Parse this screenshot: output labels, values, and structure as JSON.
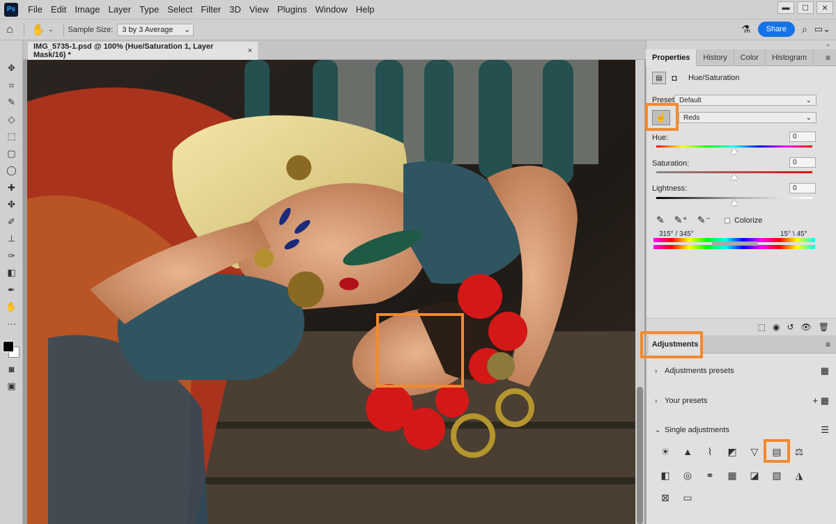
{
  "app": {
    "logo": "Ps"
  },
  "menu": [
    "File",
    "Edit",
    "Image",
    "Layer",
    "Type",
    "Select",
    "Filter",
    "3D",
    "View",
    "Plugins",
    "Window",
    "Help"
  ],
  "window_controls": {
    "minimize": "▬",
    "maximize": "☐",
    "close": "✕"
  },
  "options_bar": {
    "sample_size_label": "Sample Size:",
    "sample_size_value": "3 by 3 Average",
    "share_label": "Share"
  },
  "document": {
    "tab_title": "IMG_5735-1.psd @ 100% (Hue/Saturation 1, Layer Mask/16) *",
    "close": "×"
  },
  "properties": {
    "tabs": [
      "Properties",
      "History",
      "Color",
      "Histogram"
    ],
    "adjustment_name": "Hue/Saturation",
    "preset_label": "Preset:",
    "preset_value": "Default",
    "channel_value": "Reds",
    "hue_label": "Hue:",
    "hue_value": "0",
    "saturation_label": "Saturation:",
    "saturation_value": "0",
    "lightness_label": "Lightness:",
    "lightness_value": "0",
    "colorize_label": "Colorize",
    "range_left": "315° / 345°",
    "range_right": "15° \\ 45°",
    "hue_slider_fraction": 0.5,
    "saturation_slider_fraction": 0.5,
    "lightness_slider_fraction": 0.5
  },
  "adjustments": {
    "tab": "Adjustments",
    "sections": [
      {
        "label": "Adjustments presets"
      },
      {
        "label": "Your presets"
      },
      {
        "label": "Single adjustments"
      }
    ]
  },
  "colors": {
    "highlight": "#f08a2f",
    "share": "#1473e6"
  }
}
